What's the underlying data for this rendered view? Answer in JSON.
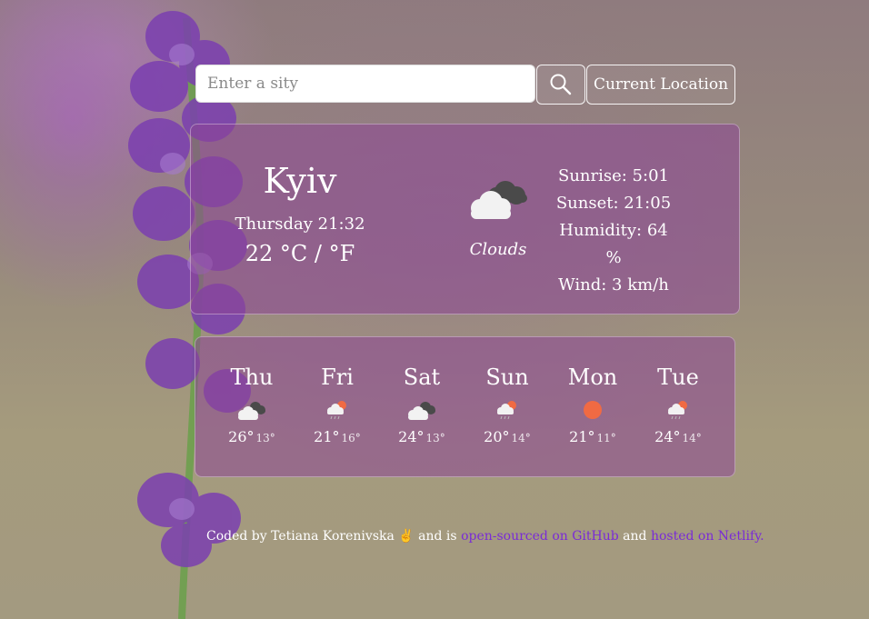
{
  "search": {
    "placeholder": "Enter a sity",
    "value": ""
  },
  "buttons": {
    "search_icon": "search-icon",
    "current_location": "Current Location"
  },
  "current": {
    "city": "Kyiv",
    "datetime": "Thursday 21:32",
    "temp_value": "22",
    "unit_c": "°C",
    "separator": "/",
    "unit_f": "°F",
    "condition": "Clouds",
    "condition_icon": "clouds-icon",
    "sunrise": "Sunrise: 5:01",
    "sunset": "Sunset: 21:05",
    "humidity": "Humidity: 64 %",
    "wind": "Wind: 3 km/h"
  },
  "forecast": [
    {
      "day": "Thu",
      "icon": "broken-clouds-icon",
      "max": "26°",
      "min": "13°"
    },
    {
      "day": "Fri",
      "icon": "rain-sun-icon",
      "max": "21°",
      "min": "16°"
    },
    {
      "day": "Sat",
      "icon": "broken-clouds-icon",
      "max": "24°",
      "min": "13°"
    },
    {
      "day": "Sun",
      "icon": "rain-sun-icon",
      "max": "20°",
      "min": "14°"
    },
    {
      "day": "Mon",
      "icon": "sun-icon",
      "max": "21°",
      "min": "11°"
    },
    {
      "day": "Tue",
      "icon": "rain-sun-icon",
      "max": "24°",
      "min": "14°"
    }
  ],
  "footer": {
    "prefix": "Coded by Tetiana Korenivska ✌ and is ",
    "github_link": "open-sourced on GitHub",
    "middle": " and ",
    "netlify_link": "hosted on Netlify."
  },
  "colors": {
    "card": "#8c4696",
    "link": "#7a2bd6",
    "sun": "#f06a43"
  }
}
